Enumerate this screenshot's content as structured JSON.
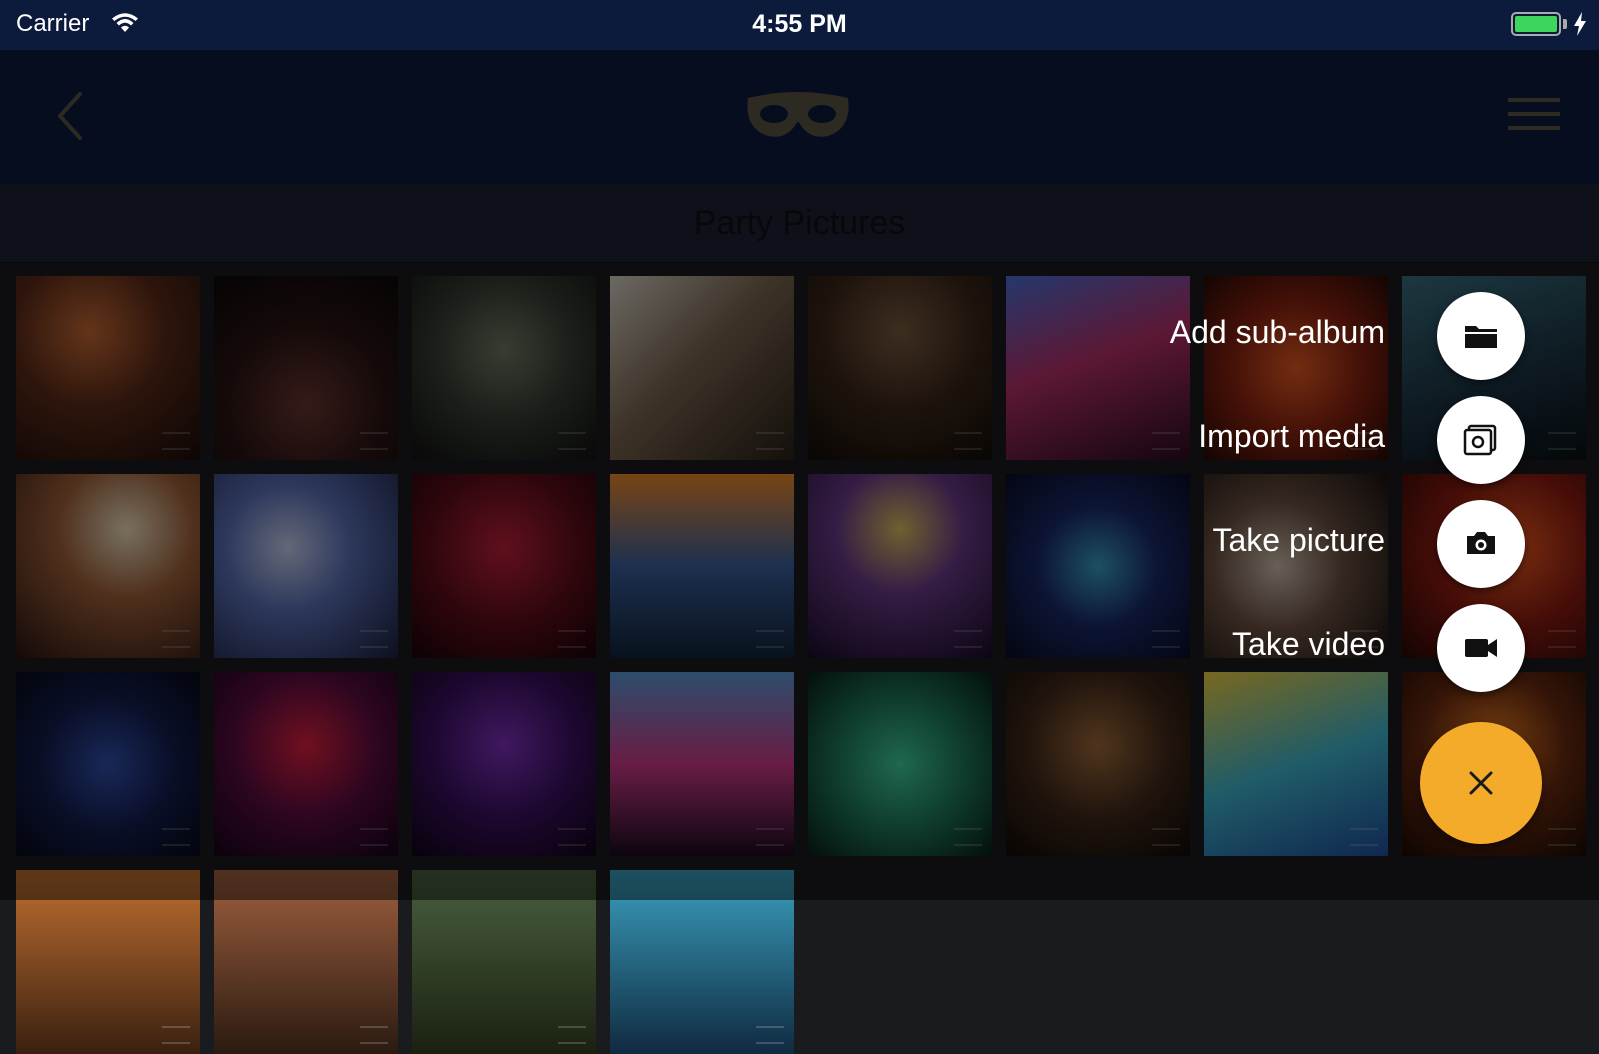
{
  "status_bar": {
    "carrier": "Carrier",
    "time": "4:55 PM"
  },
  "nav": {
    "back_icon": "chevron-left-icon",
    "logo_icon": "mask-icon",
    "menu_icon": "hamburger-menu-icon"
  },
  "album": {
    "title": "Party Pictures"
  },
  "fab_menu": {
    "items": [
      {
        "label": "Add sub-album",
        "icon": "folder-icon"
      },
      {
        "label": "Import media",
        "icon": "image-import-icon"
      },
      {
        "label": "Take picture",
        "icon": "camera-icon"
      },
      {
        "label": "Take video",
        "icon": "video-camera-icon"
      }
    ],
    "close_icon": "close-icon",
    "accent": "#f4ab2a"
  },
  "photos": [
    {
      "bg": "radial-gradient(circle at 40% 30%, #c86a35 0%, #5a2a18 45%, #1a0c08 100%)"
    },
    {
      "bg": "radial-gradient(circle at 50% 70%, #6a3530 0%, #2a1414 50%, #0c0808 100%)"
    },
    {
      "bg": "radial-gradient(circle at 50% 40%, #6f7a66 0%, #343a30 50%, #101210 100%)"
    },
    {
      "bg": "linear-gradient(135deg, #d8d2c6 0%, #7a6650 45%, #2a2018 100%)"
    },
    {
      "bg": "radial-gradient(circle at 50% 30%, #7a5a40 0%, #3a2618 50%, #120c08 100%)"
    },
    {
      "bg": "linear-gradient(160deg, #4a6fd8 0%, #b8306a 45%, #2a0c20 100%)"
    },
    {
      "bg": "radial-gradient(circle at 50% 50%, #e85a20 0%, #8a2210 50%, #2a0a06 100%)"
    },
    {
      "bg": "linear-gradient(160deg, #3a7080 0%, #1a3040 60%, #081014 100%)"
    },
    {
      "bg": "radial-gradient(circle at 60% 30%, #f2e0c0 0%, #a0603a 40%, #2a1410 100%)"
    },
    {
      "bg": "radial-gradient(circle at 40% 40%, #c8d0f0 0%, #5a70b8 40%, #1a2040 100%)"
    },
    {
      "bg": "radial-gradient(circle at 50% 40%, #c0203a 0%, #5a0c18 55%, #1a0408 100%)"
    },
    {
      "bg": "linear-gradient(180deg, #f08a2a 0%, #3a60a0 50%, #10243a 100%)"
    },
    {
      "bg": "radial-gradient(circle at 50% 30%, #e0c060 0%, #6a3a8a 40%, #1a0c2a 100%)"
    },
    {
      "bg": "radial-gradient(circle at 50% 50%, #3aa0c8 0%, #1a2a6a 45%, #080c24 100%)"
    },
    {
      "bg": "radial-gradient(circle at 40% 50%, #d0c0b0 0%, #6a5040 45%, #1a1210 100%)"
    },
    {
      "bg": "radial-gradient(circle at 60% 40%, #f05a20 0%, #8a1a10 50%, #2a0806 100%)"
    },
    {
      "bg": "radial-gradient(circle at 50% 50%, #3050b0 0%, #141e50 50%, #060818 100%)"
    },
    {
      "bg": "radial-gradient(circle at 50% 40%, #e02040 0%, #5a0c40 50%, #14041a 100%)"
    },
    {
      "bg": "radial-gradient(circle at 50% 40%, #8030c0 0%, #3a1060 50%, #100418 100%)"
    },
    {
      "bg": "linear-gradient(180deg, #5a9ad8 0%, #d03a8a 50%, #1a0a20 100%)"
    },
    {
      "bg": "radial-gradient(circle at 50% 50%, #40d0a0 0%, #208060 45%, #082018 100%)"
    },
    {
      "bg": "radial-gradient(circle at 50% 40%, #a06a3a 0%, #40281a 50%, #100a06 100%)"
    },
    {
      "bg": "linear-gradient(160deg, #f0d040 0%, #40b8d0 50%, #2050a0 100%)"
    },
    {
      "bg": "radial-gradient(circle at 50% 40%, #f08020 0%, #6a2a10 50%, #1a0a04 100%)"
    },
    {
      "bg": "linear-gradient(180deg, #c07030 0%, #3a2010 100%)"
    },
    {
      "bg": "linear-gradient(180deg, #a06040 0%, #2a1a10 100%)"
    },
    {
      "bg": "linear-gradient(180deg, #4a6040 0%, #1a2010 100%)"
    },
    {
      "bg": "linear-gradient(180deg, #3aa0c0 0%, #102a40 100%)"
    }
  ]
}
